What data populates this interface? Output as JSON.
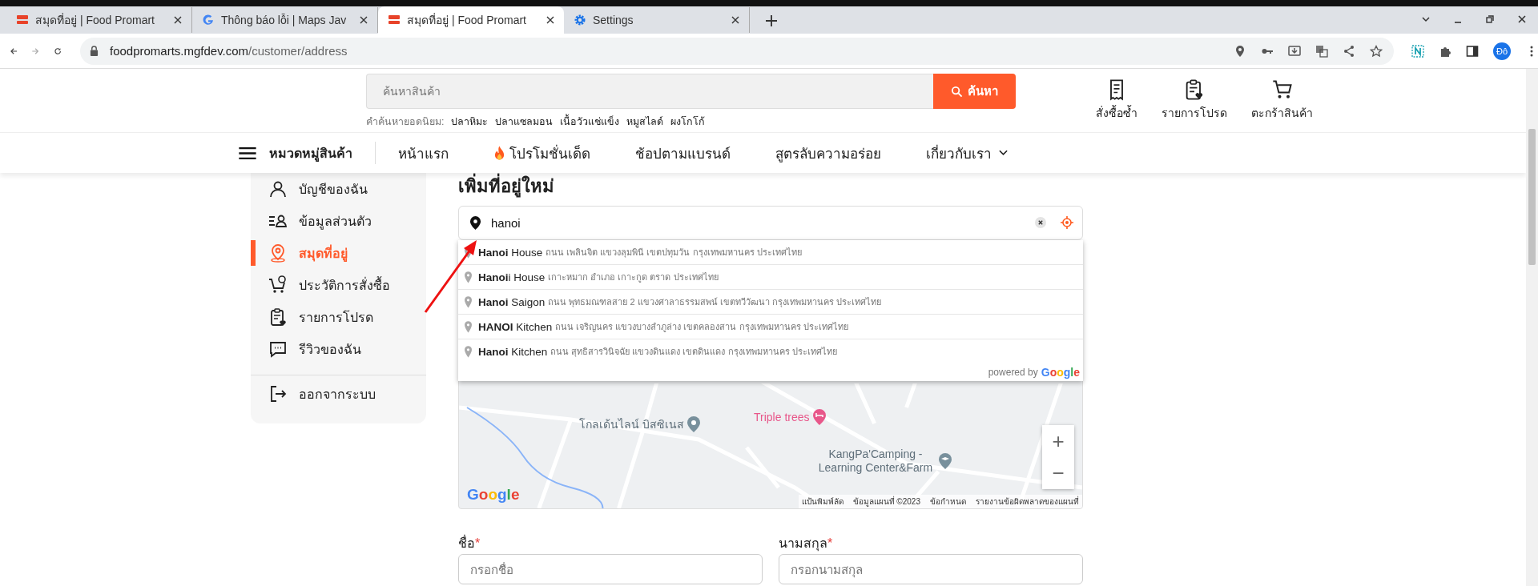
{
  "browser": {
    "tabs": [
      {
        "title": "สมุดที่อยู่ | Food Promart",
        "kind": "food",
        "selected": false
      },
      {
        "title": "Thông báo lỗi | Maps Jav",
        "kind": "google",
        "selected": false
      },
      {
        "title": "สมุดที่อยู่ | Food Promart",
        "kind": "food",
        "selected": true
      },
      {
        "title": "Settings",
        "kind": "settings",
        "selected": false
      }
    ],
    "address": {
      "host": "foodpromarts.mgfdev.com",
      "path": "/customer/address"
    },
    "profile": "Đô"
  },
  "header": {
    "search_placeholder": "ค้นหาสินค้า",
    "search_button": "ค้นหา",
    "popular_label": "คำค้นหายอดนิยม:",
    "popular": [
      "ปลาหิมะ",
      "ปลาแซลมอน",
      "เนื้อวัวแช่แข็ง",
      "หมูสไลด์",
      "ผงโกโก้"
    ],
    "actions": [
      "สั่งซื้อซ้ำ",
      "รายการโปรด",
      "ตะกร้าสินค้า"
    ]
  },
  "nav": {
    "category": "หมวดหมู่สินค้า",
    "items": [
      {
        "label": "หน้าแรก",
        "dropdown": false
      },
      {
        "label": "โปรโมชั่นเด็ด",
        "dropdown": false
      },
      {
        "label": "ช้อปตามแบรนด์",
        "dropdown": false
      },
      {
        "label": "สูตรลับความอร่อย",
        "dropdown": false
      },
      {
        "label": "เกี่ยวกับเรา",
        "dropdown": true
      }
    ]
  },
  "sidebar": {
    "items": [
      {
        "label": "บัญชีของฉัน",
        "selected": false
      },
      {
        "label": "ข้อมูลส่วนตัว",
        "selected": false
      },
      {
        "label": "สมุดที่อยู่",
        "selected": true
      },
      {
        "label": "ประวัติการสั่งซื้อ",
        "selected": false
      },
      {
        "label": "รายการโปรด",
        "selected": false
      },
      {
        "label": "รีวิวของฉัน",
        "selected": false
      }
    ],
    "logout": "ออกจากระบบ"
  },
  "form": {
    "heading": "เพิ่มที่อยู่ใหม่",
    "location_value": "hanoi",
    "suggestions": [
      {
        "name": "**Hanoi** House",
        "address": "ถนน เพลินจิต แขวงลุมพินี เขตปทุมวัน กรุงเทพมหานคร ประเทศไทย"
      },
      {
        "name": "**Hanoi**i House",
        "address": "เกาะหมาก อำเภอ เกาะกูด ตราด ประเทศไทย"
      },
      {
        "name": "**Hanoi** Saigon",
        "address": "ถนน พุทธมณฑลสาย 2 แขวงศาลาธรรมสพน์ เขตทวีวัฒนา กรุงเทพมหานคร ประเทศไทย"
      },
      {
        "name": "**HANOI** Kitchen",
        "address": "ถนน เจริญนคร แขวงบางลำภูล่าง เขตคลองสาน กรุงเทพมหานคร ประเทศไทย"
      },
      {
        "name": "**Hanoi** Kitchen",
        "address": "ถนน สุทธิสารวินิจฉัย แขวงดินแดง เขตดินแดง กรุงเทพมหานคร ประเทศไทย"
      }
    ],
    "powered_by": {
      "prefix": "powered by",
      "logo": "Google"
    },
    "map": {
      "labels": [
        {
          "text": "โกลเด้นไลน์ บิสซิเนส",
          "kind": "place"
        },
        {
          "text": "Triple trees",
          "kind": "hotel"
        },
        {
          "text": "KangPa'Camping - Learning Center&Farm",
          "kind": "school"
        }
      ],
      "logo": "Google",
      "zoom": [
        "+",
        "−"
      ],
      "attribution": [
        "แป้นพิมพ์ลัด",
        "ข้อมูลแผนที่ ©2023",
        "ข้อกำหนด",
        "รายงานข้อผิดพลาดของแผนที่"
      ]
    },
    "fields": [
      {
        "label": "ชื่อ",
        "required_mark": "*",
        "placeholder": "กรอกชื่อ"
      },
      {
        "label": "นามสกุล",
        "required_mark": "*",
        "placeholder": "กรอกนามสกุล"
      }
    ]
  }
}
